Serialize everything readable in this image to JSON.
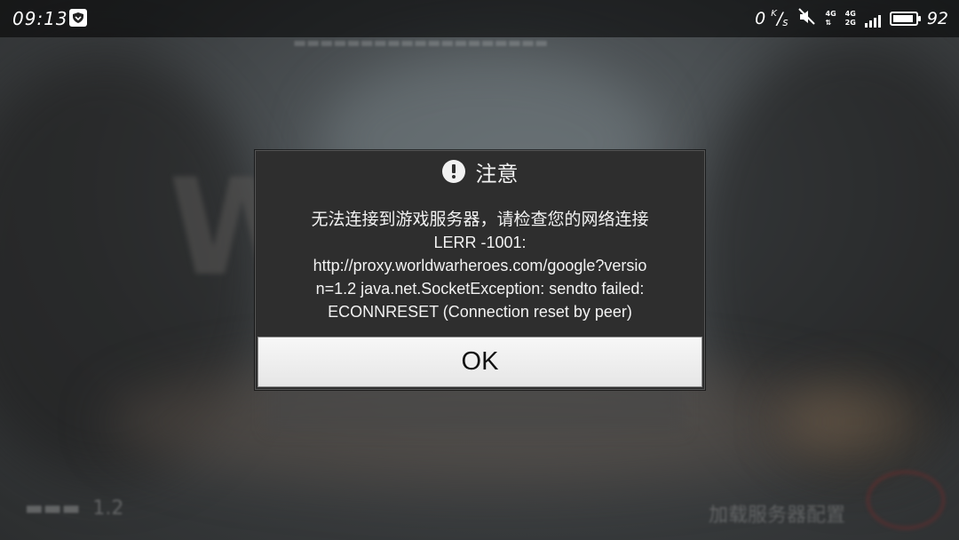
{
  "statusbar": {
    "time": "09:13",
    "speed": "0",
    "speed_unit_top": "K",
    "speed_unit_bottom": "s",
    "net_top": "4G",
    "net_sub_top": "4G",
    "net_sub_bottom": "2G",
    "battery_level": 92,
    "battery_text": "92"
  },
  "dialog": {
    "title": "注意",
    "message_lines": [
      "无法连接到游戏服务器，请检查您的网络连接",
      "LERR -1001:",
      "http://proxy.worldwarheroes.com/google?versio",
      "n=1.2 java.net.SocketException: sendto failed:",
      "ECONNRESET (Connection reset by peer)"
    ],
    "ok_label": "OK"
  },
  "background": {
    "version": "1.2",
    "loading_text": "加载服务器配置"
  },
  "colors": {
    "dialog_bg": "#2e2e2e",
    "button_bg": "#f0f0f0",
    "text": "#f2f2f2"
  }
}
